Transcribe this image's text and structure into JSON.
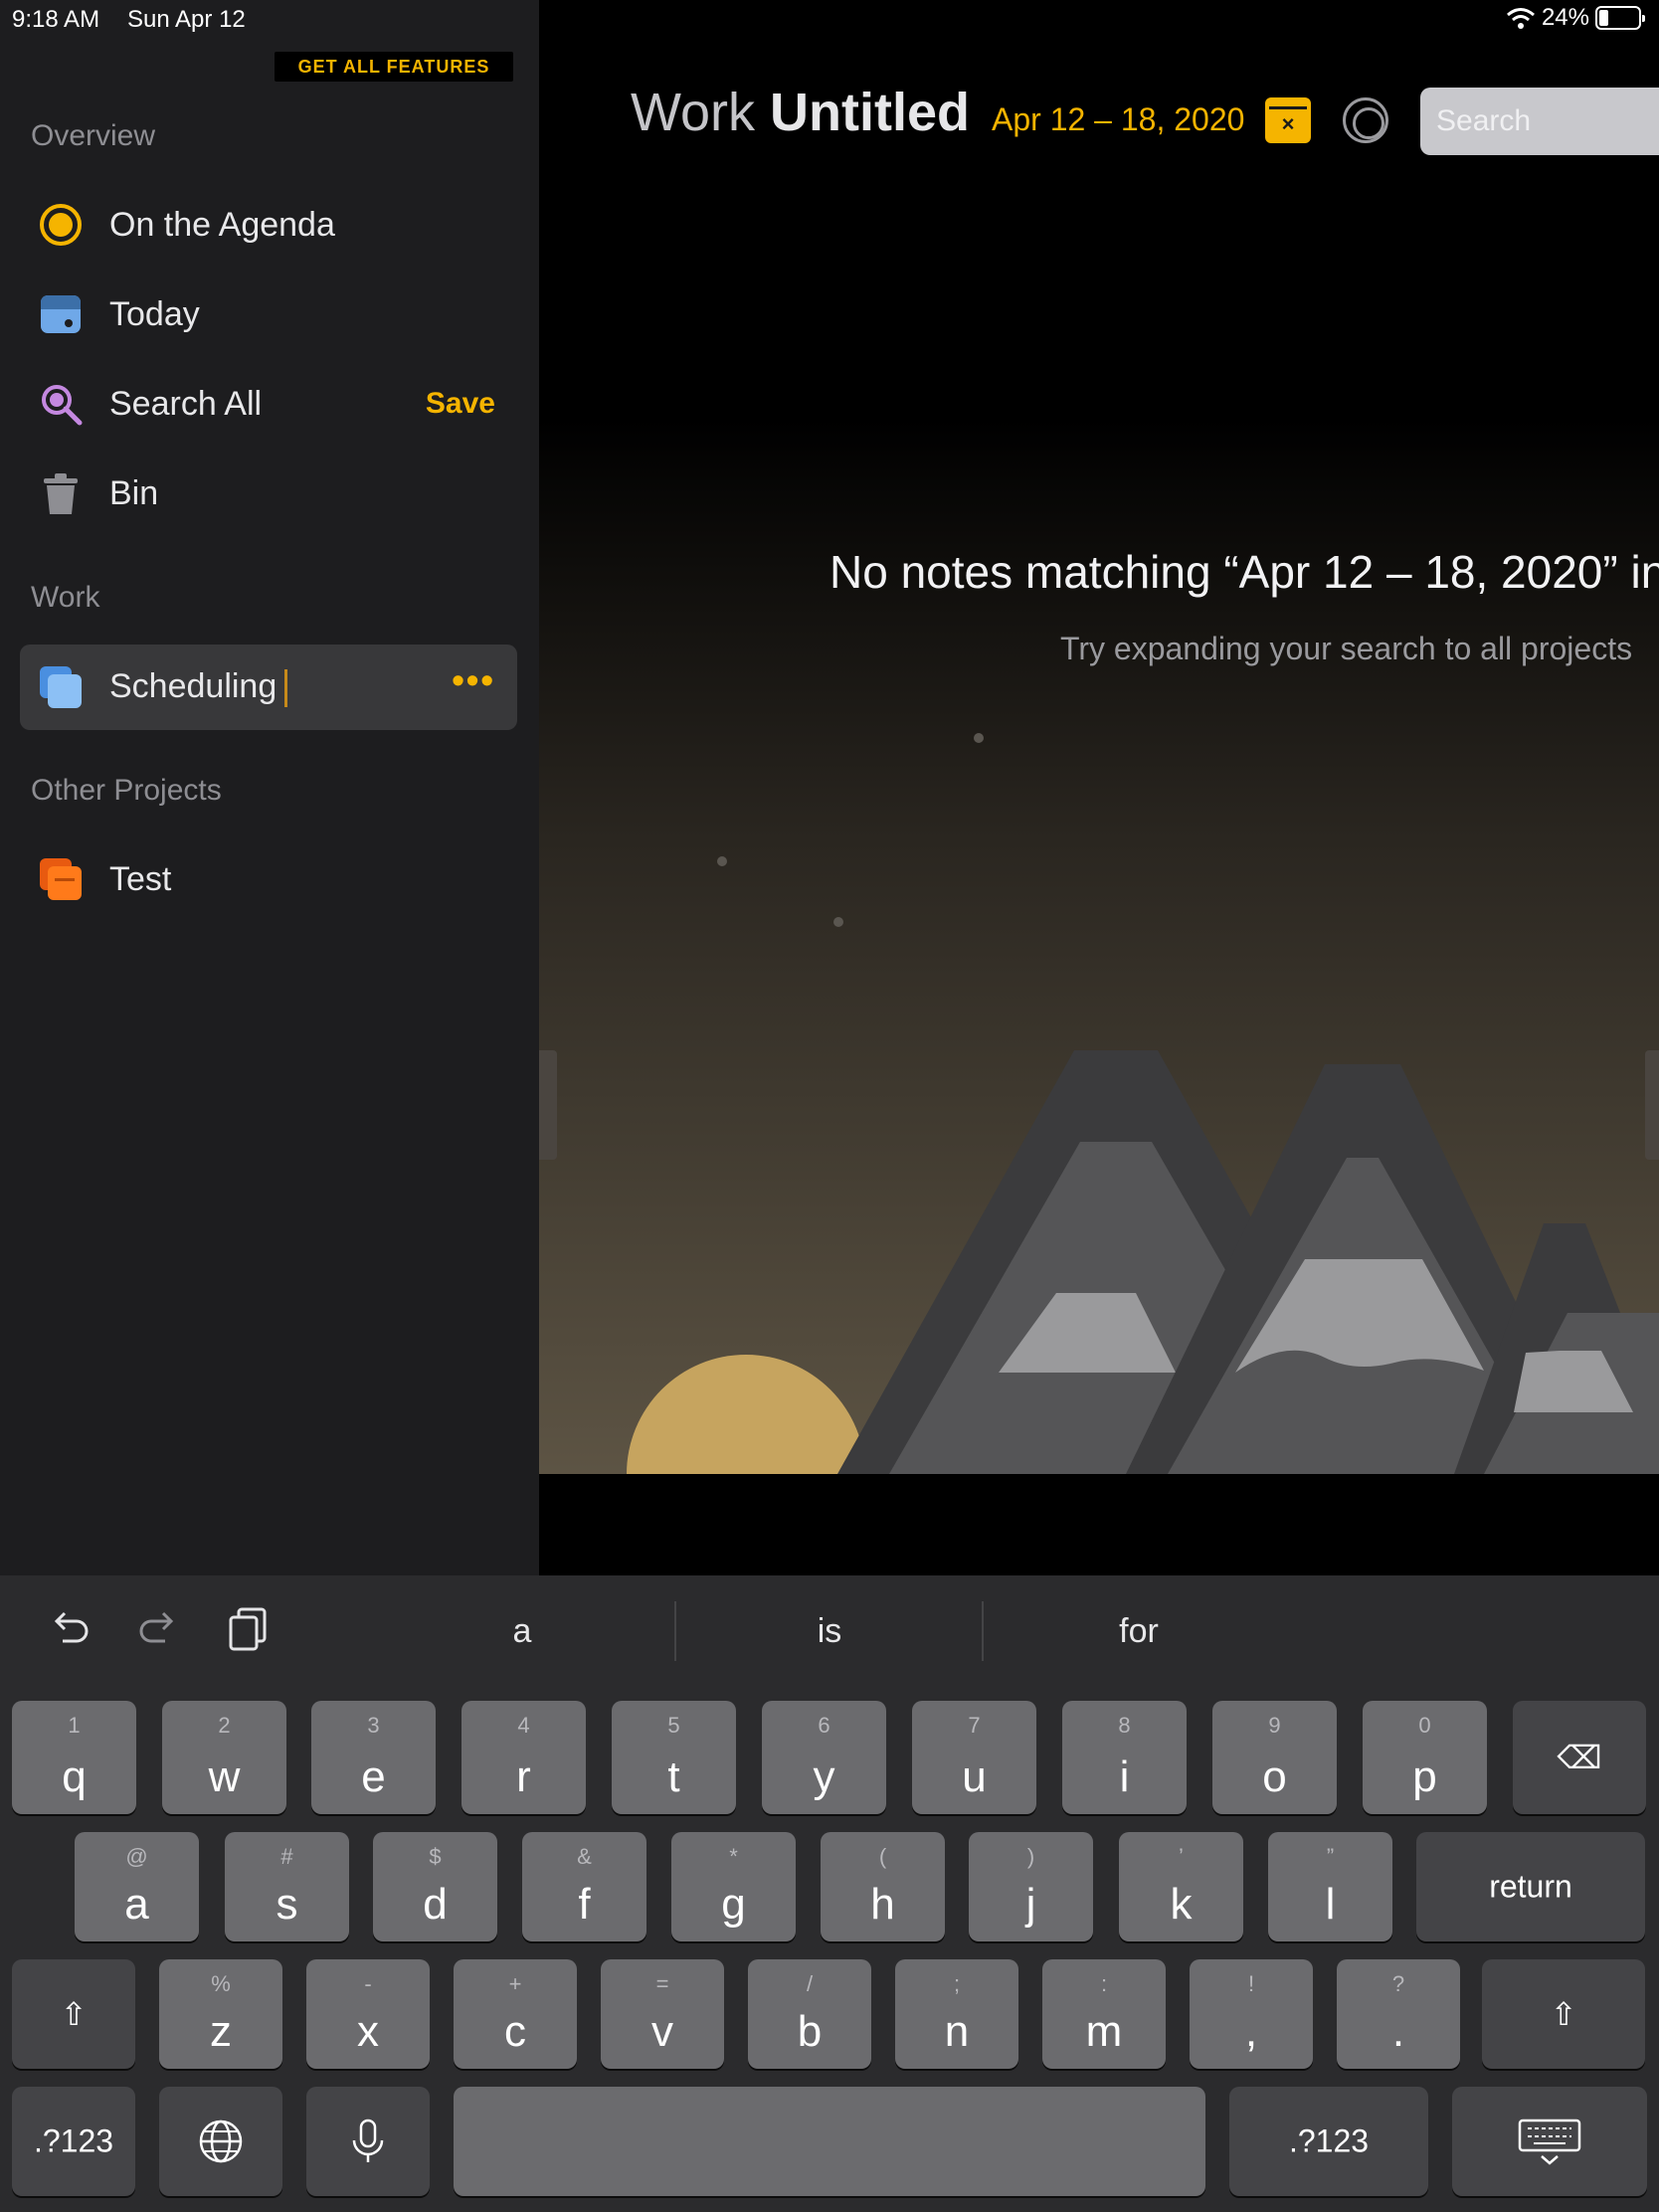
{
  "status_bar": {
    "time": "9:18 AM",
    "date": "Sun Apr 12",
    "battery": "24%",
    "battery_level": 0.24
  },
  "sidebar": {
    "promo": "GET ALL FEATURES",
    "overview_title": "Overview",
    "overview_items": [
      {
        "label": "On the Agenda",
        "icon": "agenda-icon"
      },
      {
        "label": "Today",
        "icon": "calendar-icon"
      },
      {
        "label": "Search All",
        "icon": "search-icon",
        "action": "Save"
      },
      {
        "label": "Bin",
        "icon": "trash-icon"
      }
    ],
    "work_title": "Work",
    "work_items": [
      {
        "label": "Scheduling",
        "icon": "notes-icon",
        "more": "•••"
      }
    ],
    "other_title": "Other Projects",
    "other_items": [
      {
        "label": "Test",
        "icon": "notes-icon"
      }
    ]
  },
  "header": {
    "project": "Work",
    "note_title": "Untitled",
    "date_range": "Apr 12 – 18, 2020",
    "calendar_close": "×",
    "search_placeholder": "Search"
  },
  "empty_state": {
    "title": "No notes matching “Apr 12 – 18, 2020” in",
    "subtitle": "Try expanding your search to all projects"
  },
  "keyboard": {
    "suggestions": [
      "a",
      "is",
      "for"
    ],
    "toolbar_icons": [
      "undo-icon",
      "redo-icon",
      "clipboard-icon"
    ],
    "row1": [
      {
        "k": "q",
        "s": "1"
      },
      {
        "k": "w",
        "s": "2"
      },
      {
        "k": "e",
        "s": "3"
      },
      {
        "k": "r",
        "s": "4"
      },
      {
        "k": "t",
        "s": "5"
      },
      {
        "k": "y",
        "s": "6"
      },
      {
        "k": "u",
        "s": "7"
      },
      {
        "k": "i",
        "s": "8"
      },
      {
        "k": "o",
        "s": "9"
      },
      {
        "k": "p",
        "s": "0"
      }
    ],
    "row2": [
      {
        "k": "a",
        "s": "@"
      },
      {
        "k": "s",
        "s": "#"
      },
      {
        "k": "d",
        "s": "$"
      },
      {
        "k": "f",
        "s": "&"
      },
      {
        "k": "g",
        "s": "*"
      },
      {
        "k": "h",
        "s": "("
      },
      {
        "k": "j",
        "s": ")"
      },
      {
        "k": "k",
        "s": "’"
      },
      {
        "k": "l",
        "s": "”"
      }
    ],
    "row3": [
      {
        "k": "z",
        "s": "%"
      },
      {
        "k": "x",
        "s": "-"
      },
      {
        "k": "c",
        "s": "+"
      },
      {
        "k": "v",
        "s": "="
      },
      {
        "k": "b",
        "s": "/"
      },
      {
        "k": "n",
        "s": ";"
      },
      {
        "k": "m",
        "s": ":"
      },
      {
        "k": ",",
        "s": "!"
      },
      {
        "k": ".",
        "s": "?"
      }
    ],
    "return_label": "return",
    "numbers_label": ".?123",
    "backspace": "⌫",
    "shift": "⇧"
  }
}
